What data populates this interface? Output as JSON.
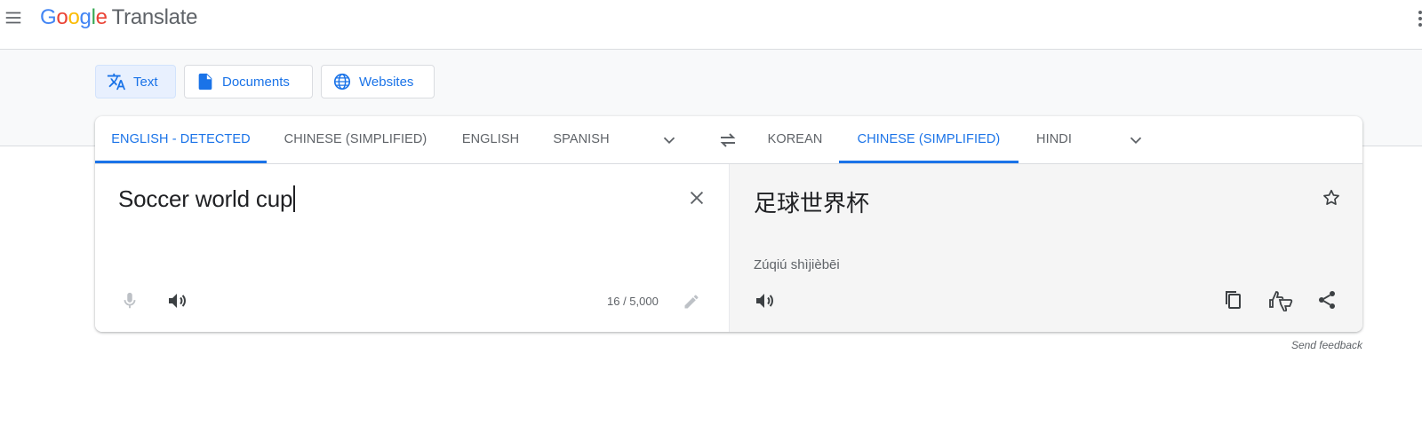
{
  "app": {
    "logo": {
      "letters": [
        "G",
        "o",
        "o",
        "g",
        "l",
        "e"
      ],
      "product": "Translate"
    }
  },
  "modes": [
    {
      "label": "Text",
      "icon": "translate-icon",
      "active": true
    },
    {
      "label": "Documents",
      "icon": "document-icon",
      "active": false
    },
    {
      "label": "Websites",
      "icon": "globe-icon",
      "active": false
    }
  ],
  "source_langs": [
    {
      "label": "English - Detected",
      "active": true
    },
    {
      "label": "Chinese (Simplified)",
      "active": false
    },
    {
      "label": "English",
      "active": false
    },
    {
      "label": "Spanish",
      "active": false
    }
  ],
  "target_langs": [
    {
      "label": "Korean",
      "active": false
    },
    {
      "label": "Chinese (Simplified)",
      "active": true
    },
    {
      "label": "Hindi",
      "active": false
    }
  ],
  "source": {
    "text": "Soccer world cup",
    "char_count": "16 / 5,000"
  },
  "target": {
    "text": "足球世界杯",
    "transliteration": "Zúqiú shìjièbēi"
  },
  "feedback_label": "Send feedback",
  "colors": {
    "accent": "#1a73e8",
    "muted": "#5f6368",
    "active_bg": "#e8f0fe"
  }
}
